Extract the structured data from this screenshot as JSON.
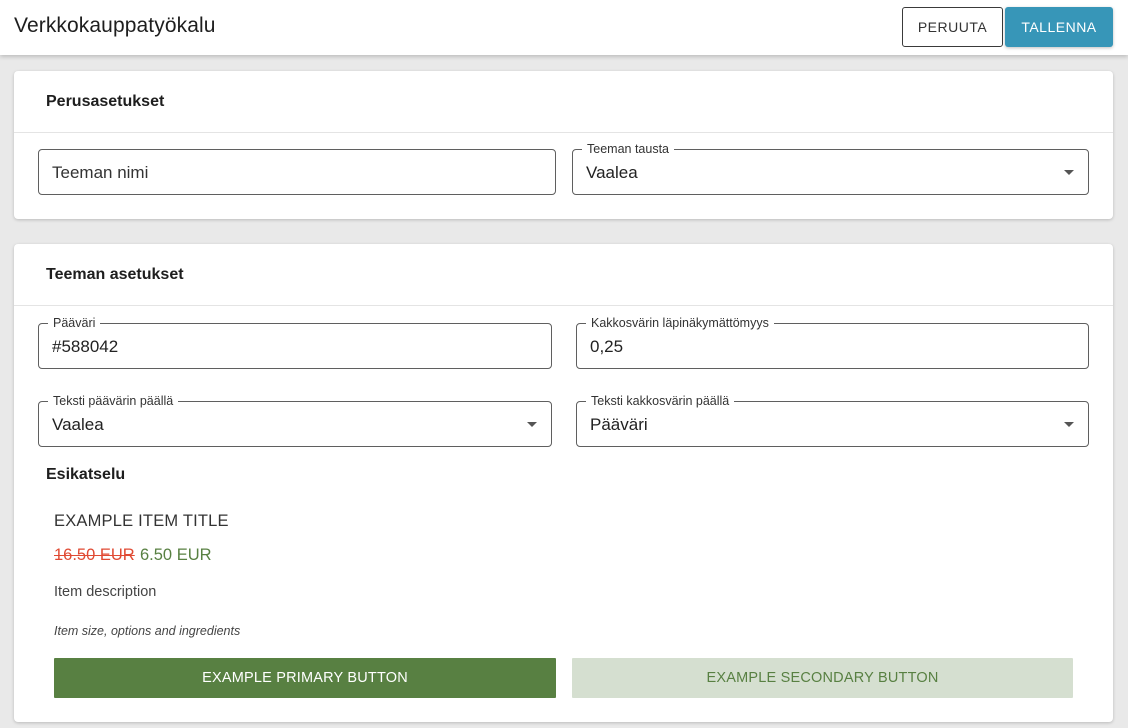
{
  "app": {
    "title": "Verkkokauppatyökalu",
    "cancel_label": "PERUUTA",
    "save_label": "TALLENNA",
    "save_color": "#3796b8"
  },
  "basic_settings": {
    "title": "Perusasetukset",
    "theme_name": {
      "placeholder": "Teeman nimi",
      "value": ""
    },
    "theme_background": {
      "label": "Teeman tausta",
      "value": "Vaalea"
    }
  },
  "theme_settings": {
    "title": "Teeman asetukset",
    "primary_color": {
      "label": "Pääväri",
      "value": "#588042"
    },
    "secondary_opacity": {
      "label": "Kakkosvärin läpinäkymättömyys",
      "value": "0,25"
    },
    "text_on_primary": {
      "label": "Teksti päävärin päällä",
      "value": "Vaalea"
    },
    "text_on_secondary": {
      "label": "Teksti kakkosvärin päällä",
      "value": "Pääväri"
    }
  },
  "preview": {
    "title": "Esikatselu",
    "item_title": "EXAMPLE ITEM TITLE",
    "old_price": "16.50 EUR",
    "new_price": "6.50 EUR",
    "description": "Item description",
    "options": "Item size, options and ingredients",
    "primary_button": "EXAMPLE PRIMARY BUTTON",
    "secondary_button": "EXAMPLE SECONDARY BUTTON",
    "colors": {
      "primary": "#588042",
      "sale": "#e04a33"
    }
  }
}
